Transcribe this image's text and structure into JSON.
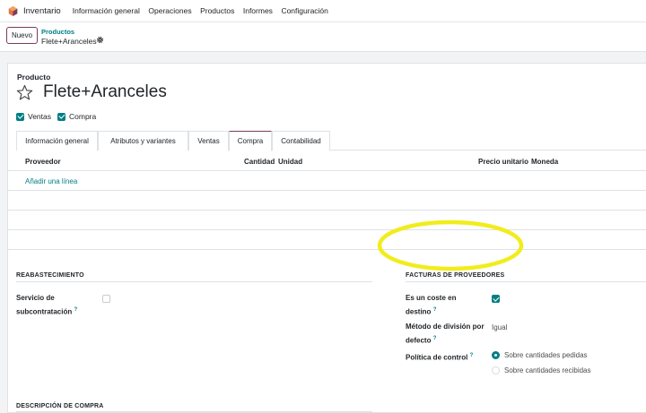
{
  "navbar": {
    "app_name": "Inventario",
    "menu": [
      "Información general",
      "Operaciones",
      "Productos",
      "Informes",
      "Configuración"
    ]
  },
  "control": {
    "new_button": "Nuevo",
    "breadcrumb_parent": "Productos",
    "breadcrumb_current": "Flete+Aranceles"
  },
  "product": {
    "label": "Producto",
    "name": "Flete+Aranceles",
    "can_be_sold_label": "Ventas",
    "can_be_purchased_label": "Compra"
  },
  "tabs": [
    "Información general",
    "Atributos y variantes",
    "Ventas",
    "Compra",
    "Contabilidad"
  ],
  "active_tab": "Compra",
  "vendor_table": {
    "columns": [
      "Proveedor",
      "Cantidad",
      "Unidad",
      "Precio unitario",
      "Moneda"
    ],
    "add_line": "Añadir una línea"
  },
  "replenishment": {
    "title": "REABASTECIMIENTO",
    "subcontracting_label_1": "Servicio de",
    "subcontracting_label_2": "subcontratación",
    "help_mark": "?"
  },
  "vendor_bills": {
    "title": "FACTURAS DE PROVEEDORES",
    "landed_cost_label_1": "Es un coste en",
    "landed_cost_label_2": "destino",
    "split_method_label_1": "Método de división por",
    "split_method_label_2": "defecto",
    "split_method_value": "Igual",
    "control_policy_label": "Política de control",
    "policy_options": [
      "Sobre cantidades pedidas",
      "Sobre cantidades recibidas"
    ]
  },
  "purchase_description": {
    "title": "DESCRIPCIÓN DE COMPRA"
  },
  "colors": {
    "accent": "#017e84",
    "brand": "#7a3d5c",
    "highlight": "#f2ec1c"
  }
}
